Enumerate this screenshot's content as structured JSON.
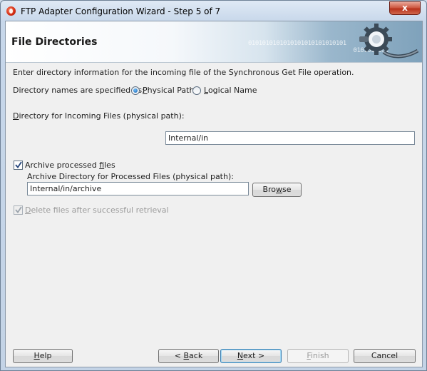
{
  "window": {
    "title": "FTP Adapter Configuration Wizard - Step 5 of 7",
    "close_glyph": "x"
  },
  "banner": {
    "title": "File Directories",
    "binary_pattern": "0101010101010101010101010101\n                              0101010101"
  },
  "form": {
    "intro": "Enter directory information for the incoming file of the Synchronous Get File operation.",
    "directory_names_label": "Directory names are specified as:",
    "radio_options": [
      {
        "pre": "",
        "hotkey": "P",
        "post": "hysical Path",
        "selected": true
      },
      {
        "pre": "",
        "hotkey": "L",
        "post": "ogical Name",
        "selected": false
      }
    ],
    "incoming_label": {
      "pre": "",
      "hotkey": "D",
      "post": "irectory for Incoming Files (physical path):"
    },
    "incoming_value": "Internal/in",
    "archive_checkbox": {
      "pre": "Archive processed ",
      "hotkey": "f",
      "post": "iles",
      "checked": true
    },
    "archive_dir_label": "Archive Directory for Processed Files (physical path):",
    "archive_dir_value": "Internal/in/archive",
    "browse_button": {
      "pre": "Bro",
      "hotkey": "w",
      "post": "se"
    },
    "delete_checkbox": {
      "pre": "",
      "hotkey": "D",
      "post": "elete files after successful retrieval",
      "checked": true,
      "enabled": false
    }
  },
  "footer": {
    "help": {
      "pre": "",
      "hotkey": "H",
      "post": "elp"
    },
    "back": {
      "pre": "< ",
      "hotkey": "B",
      "post": "ack"
    },
    "next": {
      "pre": "",
      "hotkey": "N",
      "post": "ext >"
    },
    "finish": {
      "pre": "",
      "hotkey": "F",
      "post": "inish",
      "enabled": false
    },
    "cancel": {
      "pre": "Cancel",
      "hotkey": "",
      "post": ""
    }
  }
}
